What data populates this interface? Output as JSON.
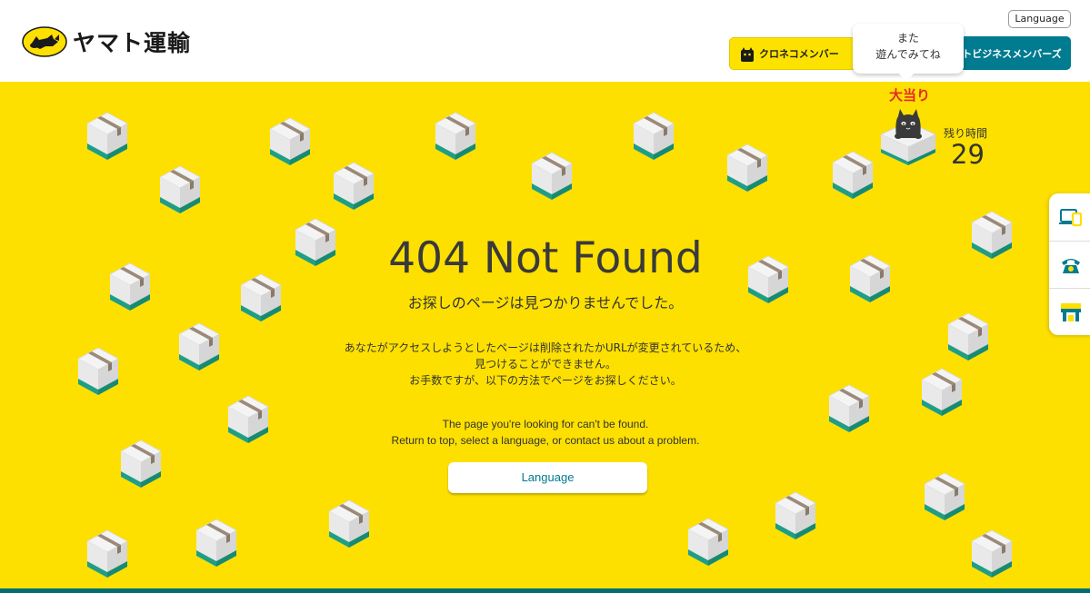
{
  "header": {
    "logo_text": "ヤマト運輸",
    "language_button": "Language",
    "kuroneko_member_label": "クロネコメンバー",
    "business_member_label": "トビジネスメンバーズ"
  },
  "game": {
    "tooltip_line1": "また",
    "tooltip_line2": "遊んでみてね",
    "jackpot_label": "大当り",
    "remaining_label": "残り時間",
    "remaining_value": "29"
  },
  "error": {
    "title": "404 Not Found",
    "subtitle": "お探しのページは見つかりませんでした。",
    "desc_jp_line1": "あなたがアクセスしようとしたページは削除されたかURLが変更されているため、",
    "desc_jp_line2": "見つけることができません。",
    "desc_jp_line3": "お手数ですが、以下の方法でページをお探しください。",
    "desc_en_line1": "The page you're looking for can't be found.",
    "desc_en_line2": "Return to top, select a language, or contact us about a problem.",
    "language_button": "Language"
  },
  "side_menu": {
    "items": [
      {
        "icon": "devices-icon"
      },
      {
        "icon": "phone-icon"
      },
      {
        "icon": "store-icon"
      }
    ]
  },
  "colors": {
    "brand_yellow": "#fde000",
    "brand_teal": "#007b8f",
    "jackpot_red": "#e8272b"
  }
}
